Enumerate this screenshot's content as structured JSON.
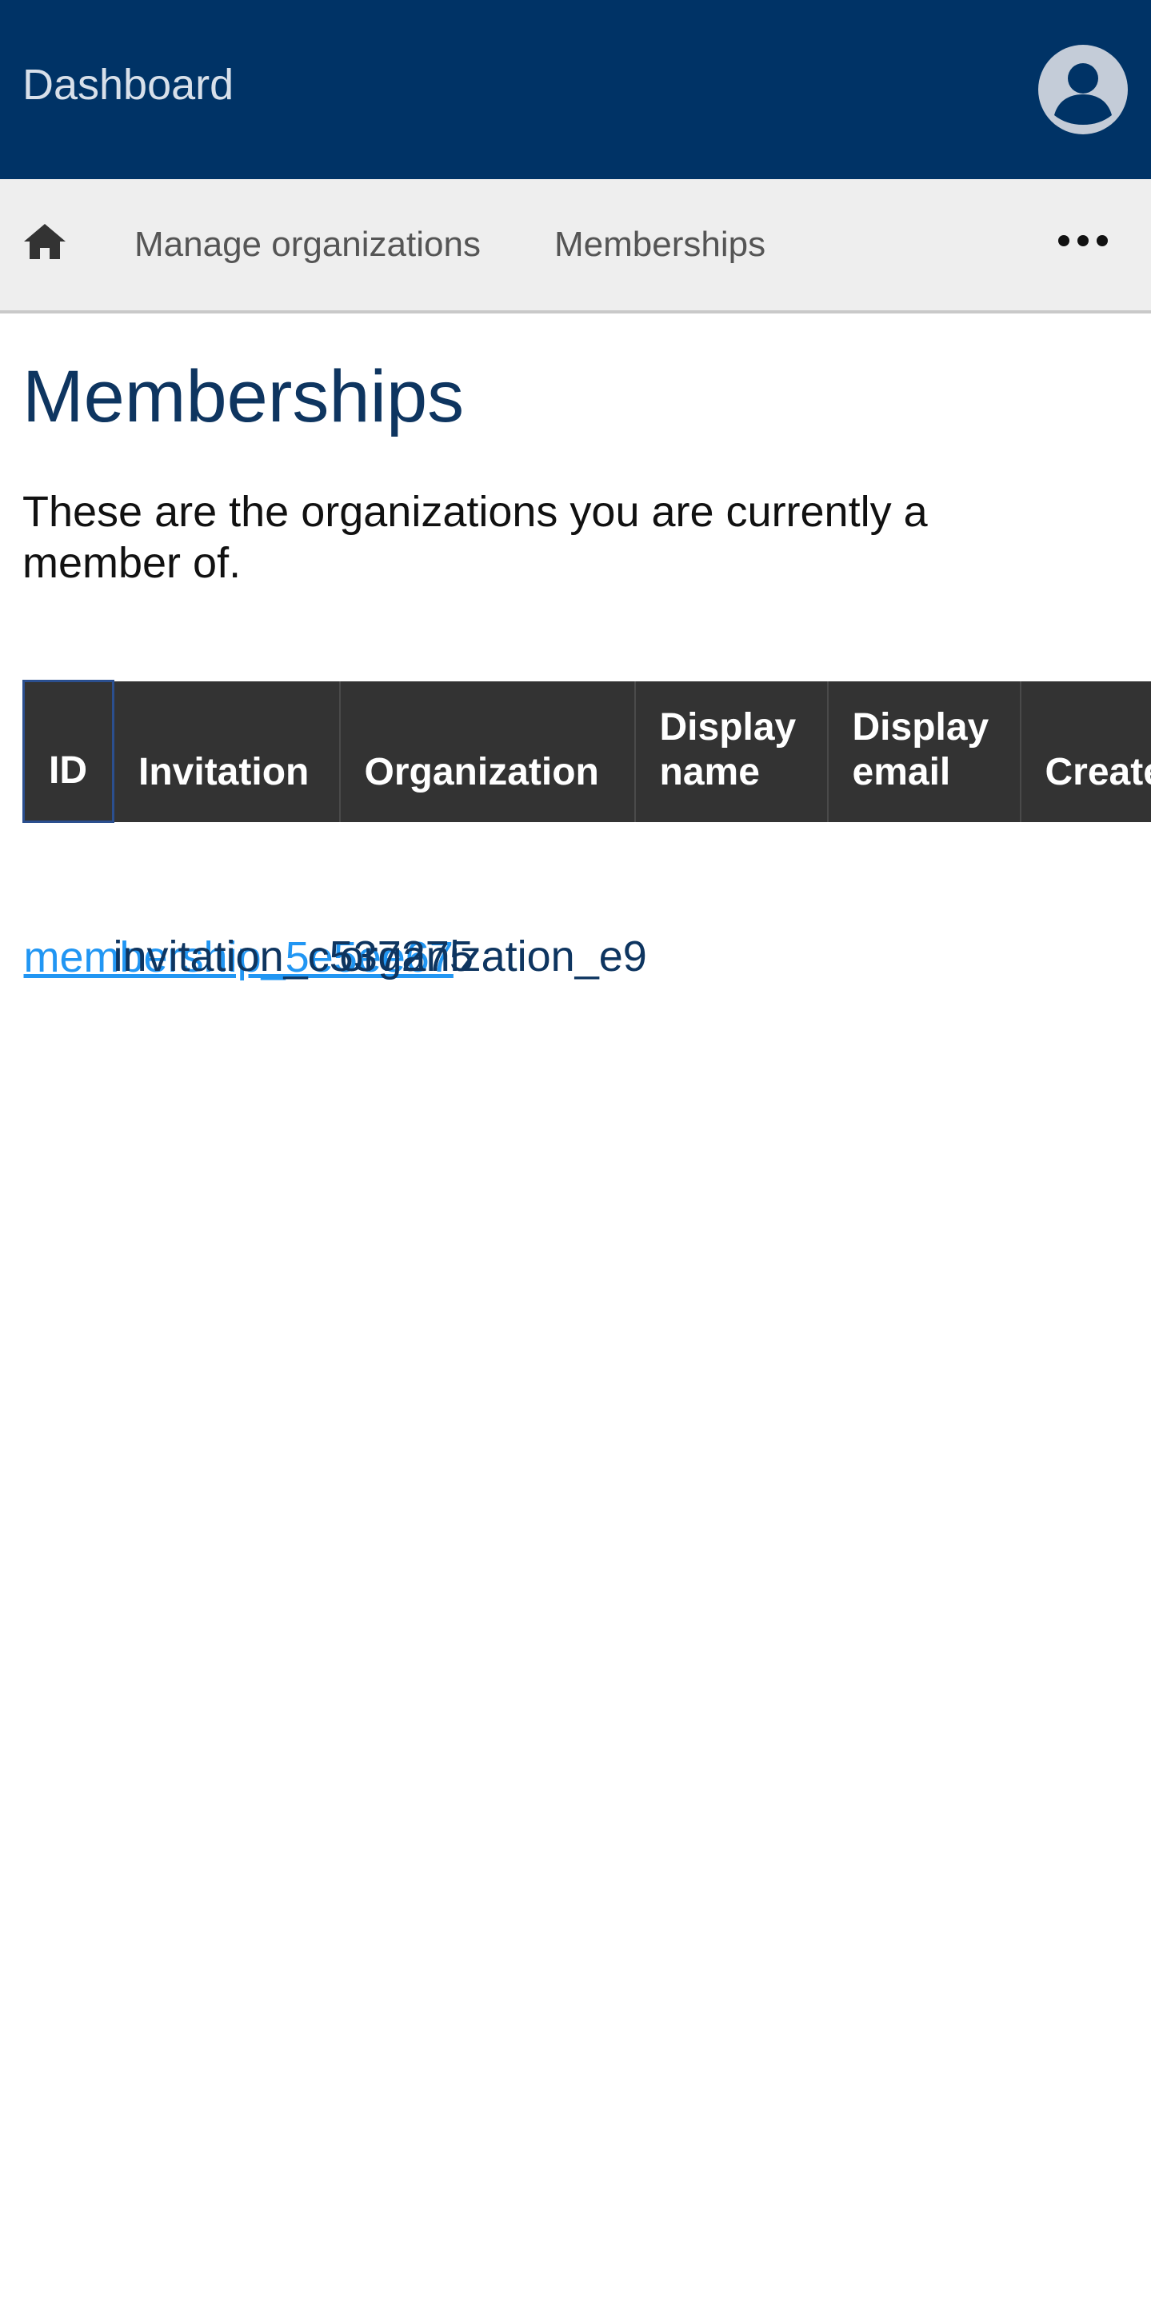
{
  "header": {
    "title": "Dashboard",
    "avatar_icon": "user-avatar-icon",
    "background_color": "#003366"
  },
  "nav": {
    "home_icon": "home-icon",
    "items": [
      {
        "label": "Manage organizations"
      },
      {
        "label": "Memberships"
      }
    ],
    "more_icon": "more-horizontal-icon"
  },
  "main": {
    "title": "Memberships",
    "intro": "These are the organizations you are currently a member of."
  },
  "table": {
    "columns": [
      "ID",
      "Invitation",
      "Organization",
      "Display name",
      "Display email",
      "Created"
    ],
    "rows": [
      {
        "id": "membership_5e5ee67",
        "invitation": "invitation_c537275",
        "organization": "organization_e9"
      }
    ]
  },
  "colors": {
    "link": "#2196f3",
    "table_header": "#333333",
    "title": "#0e3560"
  }
}
